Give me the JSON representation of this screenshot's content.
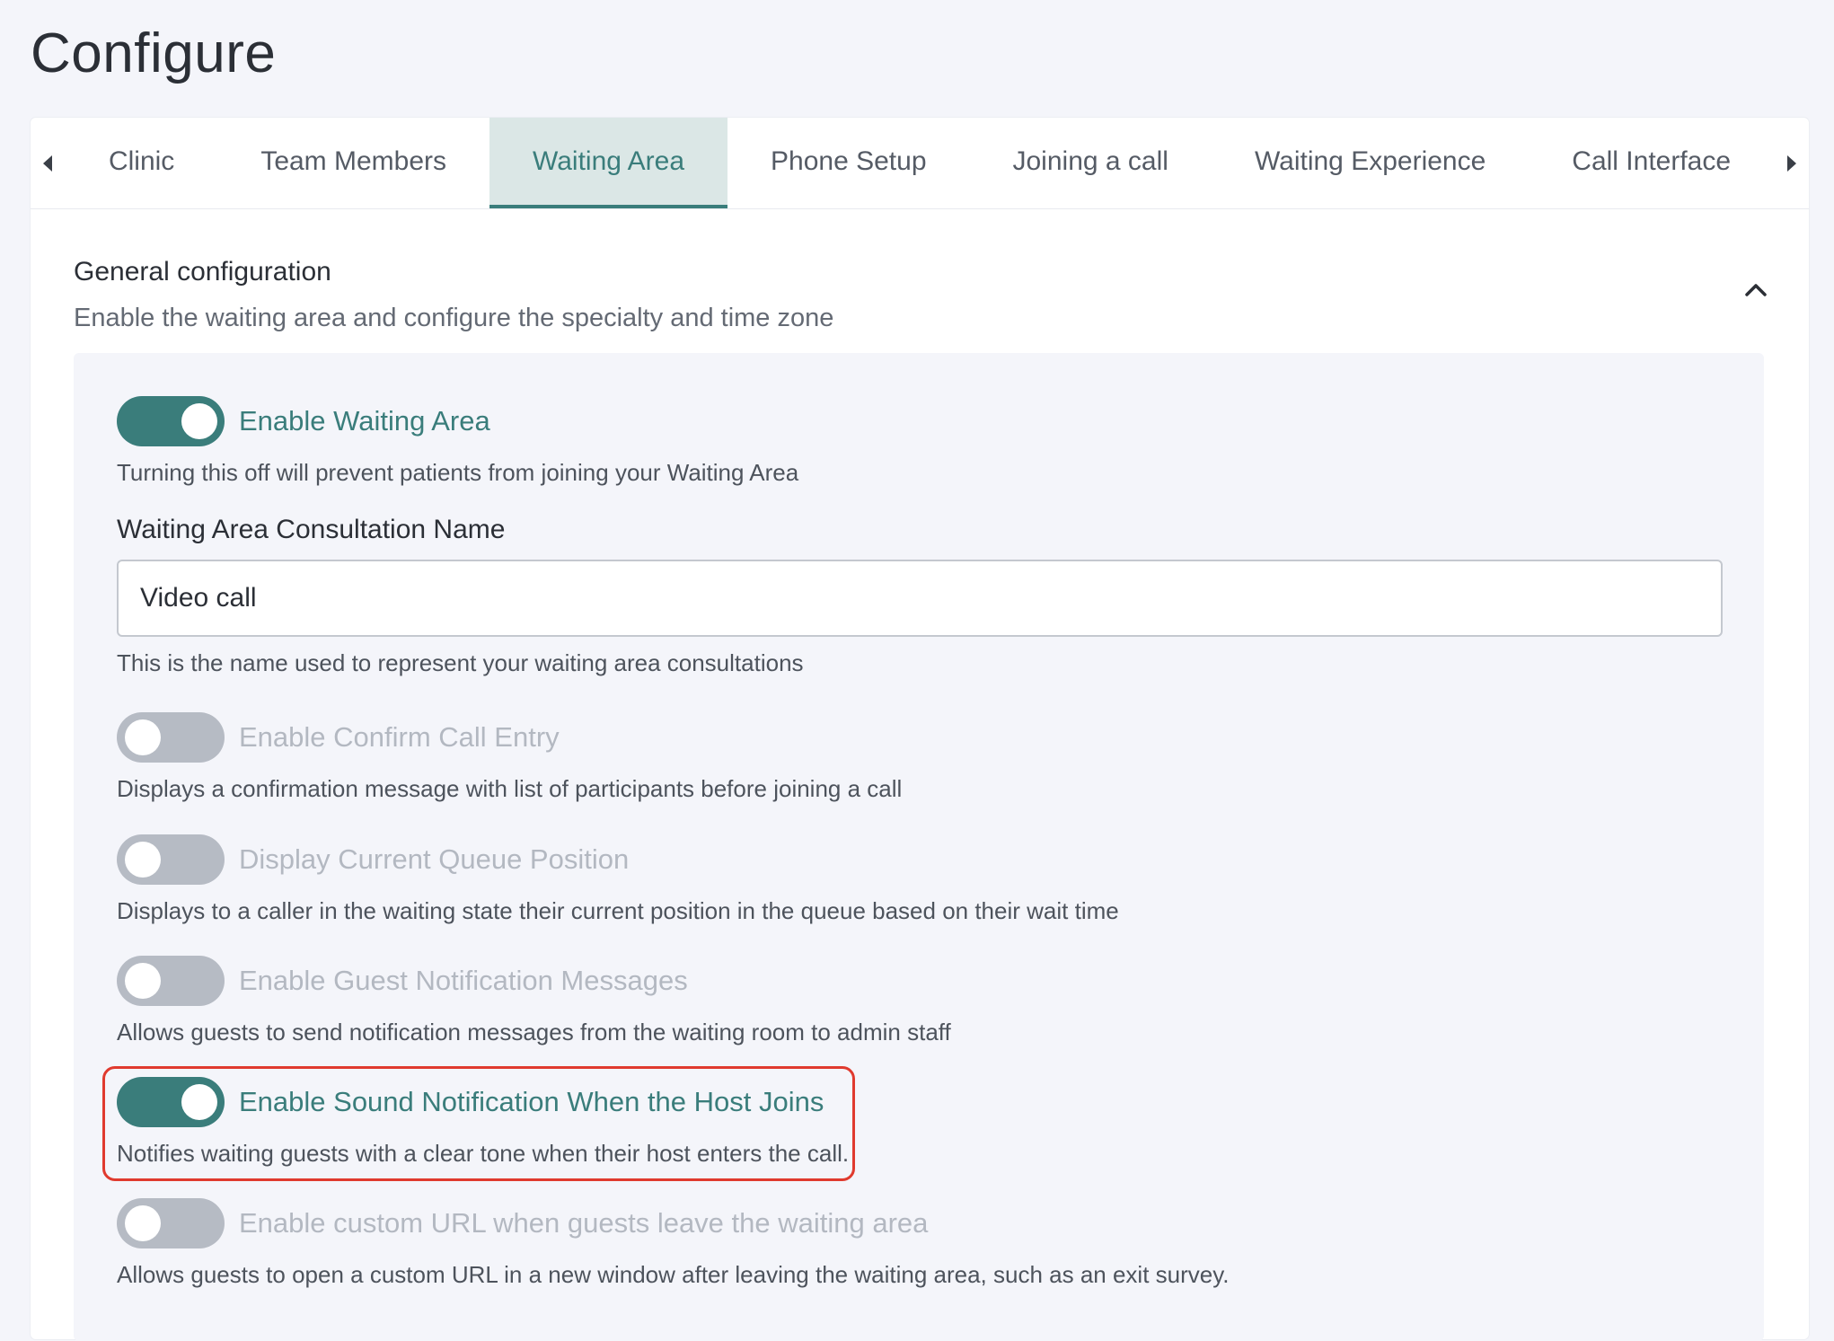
{
  "page": {
    "title": "Configure"
  },
  "tabs": {
    "prev_icon": "caret-left-icon",
    "next_icon": "caret-right-icon",
    "items": [
      {
        "label": "Clinic",
        "active": false
      },
      {
        "label": "Team Members",
        "active": false
      },
      {
        "label": "Waiting Area",
        "active": true
      },
      {
        "label": "Phone Setup",
        "active": false
      },
      {
        "label": "Joining a call",
        "active": false
      },
      {
        "label": "Waiting Experience",
        "active": false
      },
      {
        "label": "Call Interface",
        "active": false
      }
    ]
  },
  "section": {
    "title": "General configuration",
    "subtitle": "Enable the waiting area and configure the specialty and time zone",
    "collapse_icon": "chevron-up-icon",
    "expanded": true
  },
  "settings": {
    "enable_waiting_area": {
      "label": "Enable Waiting Area",
      "enabled": true,
      "description": "Turning this off will prevent patients from joining your Waiting Area"
    },
    "consultation_name": {
      "label": "Waiting Area Consultation Name",
      "value": "Video call",
      "description": "This is the name used to represent your waiting area consultations"
    },
    "confirm_call_entry": {
      "label": "Enable Confirm Call Entry",
      "enabled": false,
      "description": "Displays a confirmation message with list of participants before joining a call"
    },
    "queue_position": {
      "label": "Display Current Queue Position",
      "enabled": false,
      "description": "Displays to a caller in the waiting state their current position in the queue based on their wait time"
    },
    "guest_notifications": {
      "label": "Enable Guest Notification Messages",
      "enabled": false,
      "description": "Allows guests to send notification messages from the waiting room to admin staff"
    },
    "sound_notification": {
      "label": "Enable Sound Notification When the Host Joins",
      "enabled": true,
      "highlighted": true,
      "description": "Notifies waiting guests with a clear tone when their host enters the call."
    },
    "custom_exit_url": {
      "label": "Enable custom URL when guests leave the waiting area",
      "enabled": false,
      "description": "Allows guests to open a custom URL in a new window after leaving the waiting area, such as an exit survey."
    }
  },
  "colors": {
    "accent": "#3a7d7b",
    "active_tab_bg": "#dbe7e6",
    "toggle_off": "#b6bbc4",
    "highlight": "#e03a2e",
    "page_bg": "#f4f5fa"
  }
}
